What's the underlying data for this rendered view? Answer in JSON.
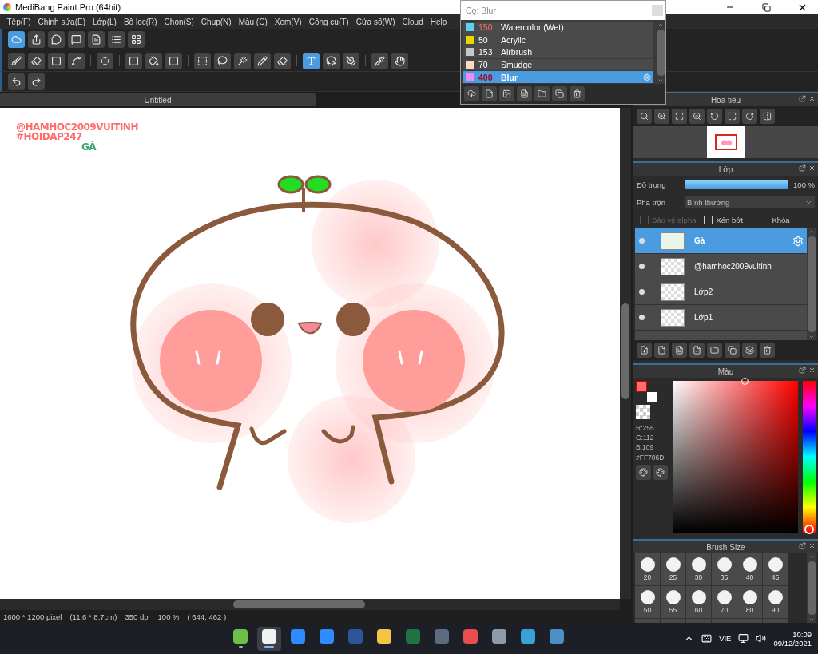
{
  "window": {
    "title": "MediBang Paint Pro (64bit)"
  },
  "menu": [
    "Tệp(F)",
    "Chỉnh sửa(E)",
    "Lớp(L)",
    "Bộ lọc(R)",
    "Chọn(S)",
    "Chụp(N)",
    "Màu (C)",
    "Xem(V)",
    "Công cụ(T)",
    "Cửa sổ(W)",
    "Cloud",
    "Help"
  ],
  "toolbars": [
    {
      "groups": [
        {
          "tools": [
            {
              "selected": true
            },
            {
              "selected": false
            },
            {
              "selected": false
            },
            {
              "selected": false
            },
            {
              "selected": false
            },
            {
              "selected": false
            },
            {
              "selected": false
            }
          ]
        }
      ]
    },
    {
      "groups": [
        {
          "tools": [
            {
              "selected": false
            },
            {
              "selected": false
            },
            {
              "selected": false
            },
            {
              "selected": false
            }
          ]
        },
        {
          "tools": [
            {
              "selected": false
            }
          ]
        },
        {
          "tools": [
            {
              "selected": false
            },
            {
              "selected": false
            },
            {
              "selected": false
            }
          ]
        },
        {
          "tools": [
            {
              "selected": false
            },
            {
              "selected": false
            },
            {
              "selected": false
            },
            {
              "selected": false
            },
            {
              "selected": false
            }
          ]
        },
        {
          "tools": [
            {
              "selected": true
            },
            {
              "selected": false
            },
            {
              "selected": false
            }
          ]
        },
        {
          "tools": [
            {
              "selected": false
            },
            {
              "selected": false
            }
          ]
        }
      ]
    },
    {
      "groups": [
        {
          "tools": [
            {
              "selected": false
            },
            {
              "selected": false
            }
          ]
        }
      ]
    }
  ],
  "document_tab": {
    "title": "Untitled"
  },
  "canvas": {
    "texts": [
      "@HAMHOC2009VUITINH",
      "#HOIDAP247"
    ],
    "layer_text": "GÀ"
  },
  "brush_popup": {
    "title": "Cọ: Blur",
    "brushes": [
      {
        "color": "#5ad2f0",
        "size": "150",
        "name": "Watercolor (Wet)",
        "size_warning": true,
        "selected": false
      },
      {
        "color": "#e8d800",
        "size": "50",
        "name": "Acrylic",
        "size_warning": false,
        "selected": false
      },
      {
        "color": "#c8c8c8",
        "size": "153",
        "name": "Airbrush",
        "size_warning": false,
        "selected": false
      },
      {
        "color": "#fcd9c0",
        "size": "70",
        "name": "Smudge",
        "size_warning": false,
        "selected": false
      },
      {
        "color": "#f08cf0",
        "size": "400",
        "name": "Blur",
        "size_warning": true,
        "selected": true
      }
    ]
  },
  "navigator": {
    "title": "Hoa tiêu"
  },
  "layers_panel": {
    "title": "Lớp",
    "opacity_label": "Độ trong",
    "opacity": {
      "level": 1.0,
      "reading": "100 %"
    },
    "blend_label": "Pha trộn",
    "blend_value": "Bình thường",
    "options": [
      {
        "label": "Bảo vệ alpha",
        "checked": false,
        "disabled": true
      },
      {
        "label": "Xén bớt",
        "checked": false,
        "disabled": false
      },
      {
        "label": "Khóa",
        "checked": false,
        "disabled": false
      }
    ],
    "layers": [
      {
        "name": "Gà",
        "selected": true
      },
      {
        "name": "@hamhoc2009vuitinh",
        "selected": false
      },
      {
        "name": "Lớp2",
        "selected": false
      },
      {
        "name": "Lớp1",
        "selected": false
      }
    ]
  },
  "color_panel": {
    "title": "Màu",
    "r": "R:255",
    "g": "G:112",
    "b": "B:109",
    "hex": "#FF706D",
    "hue": {
      "level": 0.0
    }
  },
  "brush_size_panel": {
    "title": "Brush Size",
    "sizes": [
      "20",
      "25",
      "30",
      "35",
      "40",
      "45",
      "50",
      "55",
      "60",
      "70",
      "80",
      "90"
    ]
  },
  "status_bar": [
    "1600 * 1200 pixel",
    "(11.6 * 8.7cm)",
    "350 dpi",
    "100 %",
    "( 644, 462 )"
  ],
  "taskbar": {
    "apps": [
      {
        "running": true,
        "selected": false
      },
      {
        "running": true,
        "selected": true
      },
      {
        "running": false,
        "selected": false
      },
      {
        "running": false,
        "selected": false
      },
      {
        "running": false,
        "selected": false
      },
      {
        "running": false,
        "selected": false
      },
      {
        "running": false,
        "selected": false
      },
      {
        "running": false,
        "selected": false
      },
      {
        "running": false,
        "selected": false
      },
      {
        "running": false,
        "selected": false
      },
      {
        "running": false,
        "selected": false
      },
      {
        "running": false,
        "selected": false
      }
    ],
    "language": "VIE",
    "time": "10:09",
    "date": "09/12/2021"
  }
}
